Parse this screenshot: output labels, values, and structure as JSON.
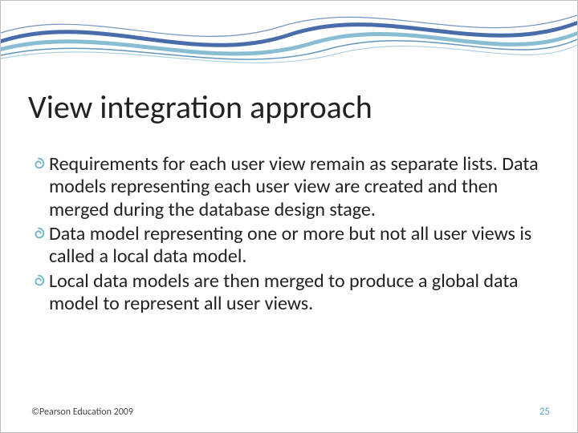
{
  "slide": {
    "title": "View integration approach",
    "bullets": [
      {
        "text": "Requirements for each user view remain as separate lists. Data models representing each user view are created and then merged during the database design stage."
      },
      {
        "text": "Data model representing one or more but not all user views is called a local data model."
      },
      {
        "text": " Local data models are then merged to produce a global data model to represent all user views."
      }
    ],
    "footer_left": "©Pearson Education 2009",
    "page_number": "25"
  }
}
